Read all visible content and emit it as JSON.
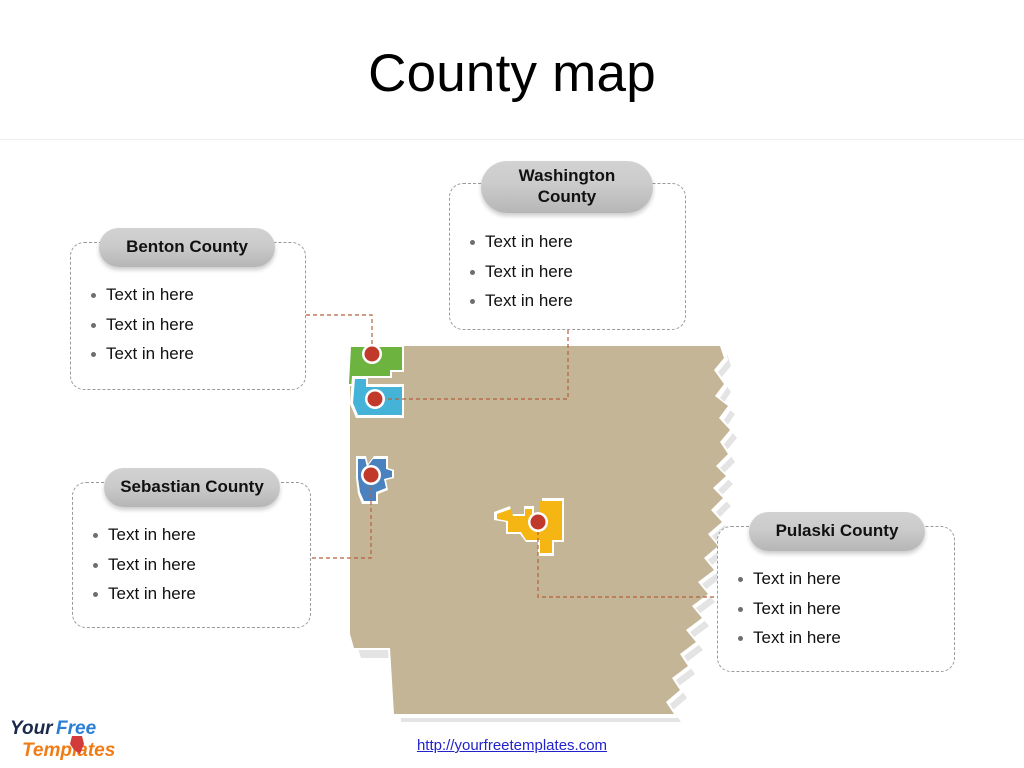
{
  "slide": {
    "title": "County map",
    "background_color": "#ffffff",
    "divider_color": "#eeeeee"
  },
  "footer": {
    "url_text": "http://yourfreetemplates.com",
    "url_color": "#2222cc",
    "logo": {
      "word1": "Your",
      "word2": "Free",
      "word3": "Templates",
      "word1_color": "#1b2a4a",
      "word2_color": "#2a7fd4",
      "word3_color": "#f07c16",
      "mark_color": "#d33a3a"
    }
  },
  "map": {
    "name": "arkansas-state-map",
    "fill_color": "#c4b596",
    "shadow_color": "#e2e2e2",
    "outline_color": "#ffffff",
    "connector_color": "#b5623c"
  },
  "counties": [
    {
      "id": "benton",
      "name": "Benton County",
      "fill_color": "#6cb33f",
      "marker_color": "#c0392b",
      "marker_ring": "#ffffff"
    },
    {
      "id": "washington",
      "name": "Washington County",
      "fill_color": "#45b2d8",
      "marker_color": "#c0392b",
      "marker_ring": "#ffffff"
    },
    {
      "id": "sebastian",
      "name": "Sebastian County",
      "fill_color": "#4a82c0",
      "marker_color": "#c0392b",
      "marker_ring": "#ffffff"
    },
    {
      "id": "pulaski",
      "name": "Pulaski County",
      "fill_color": "#f5b512",
      "marker_color": "#c0392b",
      "marker_ring": "#ffffff"
    }
  ],
  "callouts": [
    {
      "id": "benton",
      "title": "Benton County",
      "bullets": [
        "Text in here",
        "Text in here",
        "Text in here"
      ]
    },
    {
      "id": "washington",
      "title": "Washington County",
      "bullets": [
        "Text in here",
        "Text in here",
        "Text in here"
      ]
    },
    {
      "id": "sebastian",
      "title": "Sebastian County",
      "bullets": [
        "Text in here",
        "Text in here",
        "Text in here"
      ]
    },
    {
      "id": "pulaski",
      "title": "Pulaski County",
      "bullets": [
        "Text in here",
        "Text in here",
        "Text in here"
      ]
    }
  ]
}
